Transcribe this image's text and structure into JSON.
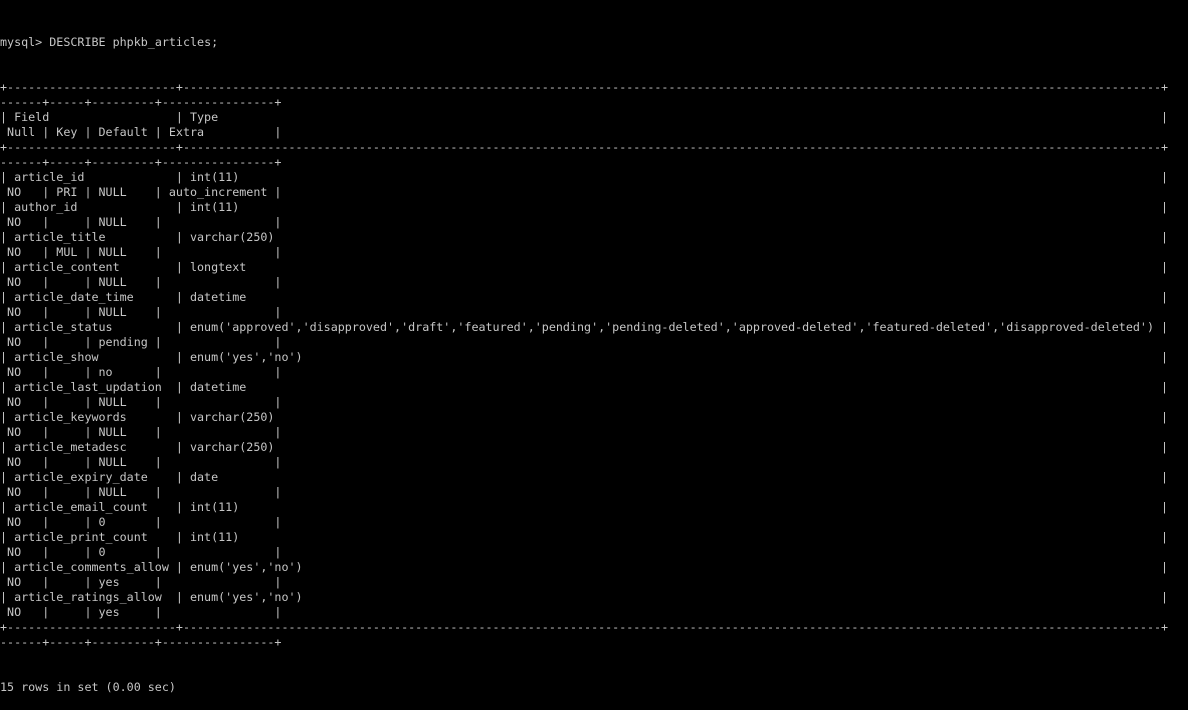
{
  "terminal": {
    "prompt": "mysql> ",
    "command": "DESCRIBE phpkb_articles;",
    "columns": [
      "Field",
      "Type",
      "Null",
      "Key",
      "Default",
      "Extra"
    ],
    "rows": [
      {
        "field": "article_id",
        "type": "int(11)",
        "null": "NO",
        "key": "PRI",
        "default": "NULL",
        "extra": "auto_increment"
      },
      {
        "field": "author_id",
        "type": "int(11)",
        "null": "NO",
        "key": "",
        "default": "NULL",
        "extra": ""
      },
      {
        "field": "article_title",
        "type": "varchar(250)",
        "null": "NO",
        "key": "MUL",
        "default": "NULL",
        "extra": ""
      },
      {
        "field": "article_content",
        "type": "longtext",
        "null": "NO",
        "key": "",
        "default": "NULL",
        "extra": ""
      },
      {
        "field": "article_date_time",
        "type": "datetime",
        "null": "NO",
        "key": "",
        "default": "NULL",
        "extra": ""
      },
      {
        "field": "article_status",
        "type": "enum('approved','disapproved','draft','featured','pending','pending-deleted','approved-deleted','featured-deleted','disapproved-deleted')",
        "null": "NO",
        "key": "",
        "default": "pending",
        "extra": ""
      },
      {
        "field": "article_show",
        "type": "enum('yes','no')",
        "null": "NO",
        "key": "",
        "default": "no",
        "extra": ""
      },
      {
        "field": "article_last_updation",
        "type": "datetime",
        "null": "NO",
        "key": "",
        "default": "NULL",
        "extra": ""
      },
      {
        "field": "article_keywords",
        "type": "varchar(250)",
        "null": "NO",
        "key": "",
        "default": "NULL",
        "extra": ""
      },
      {
        "field": "article_metadesc",
        "type": "varchar(250)",
        "null": "NO",
        "key": "",
        "default": "NULL",
        "extra": ""
      },
      {
        "field": "article_expiry_date",
        "type": "date",
        "null": "NO",
        "key": "",
        "default": "NULL",
        "extra": ""
      },
      {
        "field": "article_email_count",
        "type": "int(11)",
        "null": "NO",
        "key": "",
        "default": "0",
        "extra": ""
      },
      {
        "field": "article_print_count",
        "type": "int(11)",
        "null": "NO",
        "key": "",
        "default": "0",
        "extra": ""
      },
      {
        "field": "article_comments_allow",
        "type": "enum('yes','no')",
        "null": "NO",
        "key": "",
        "default": "yes",
        "extra": ""
      },
      {
        "field": "article_ratings_allow",
        "type": "enum('yes','no')",
        "null": "NO",
        "key": "",
        "default": "yes",
        "extra": ""
      }
    ],
    "footer": "15 rows in set (0.00 sec)"
  }
}
